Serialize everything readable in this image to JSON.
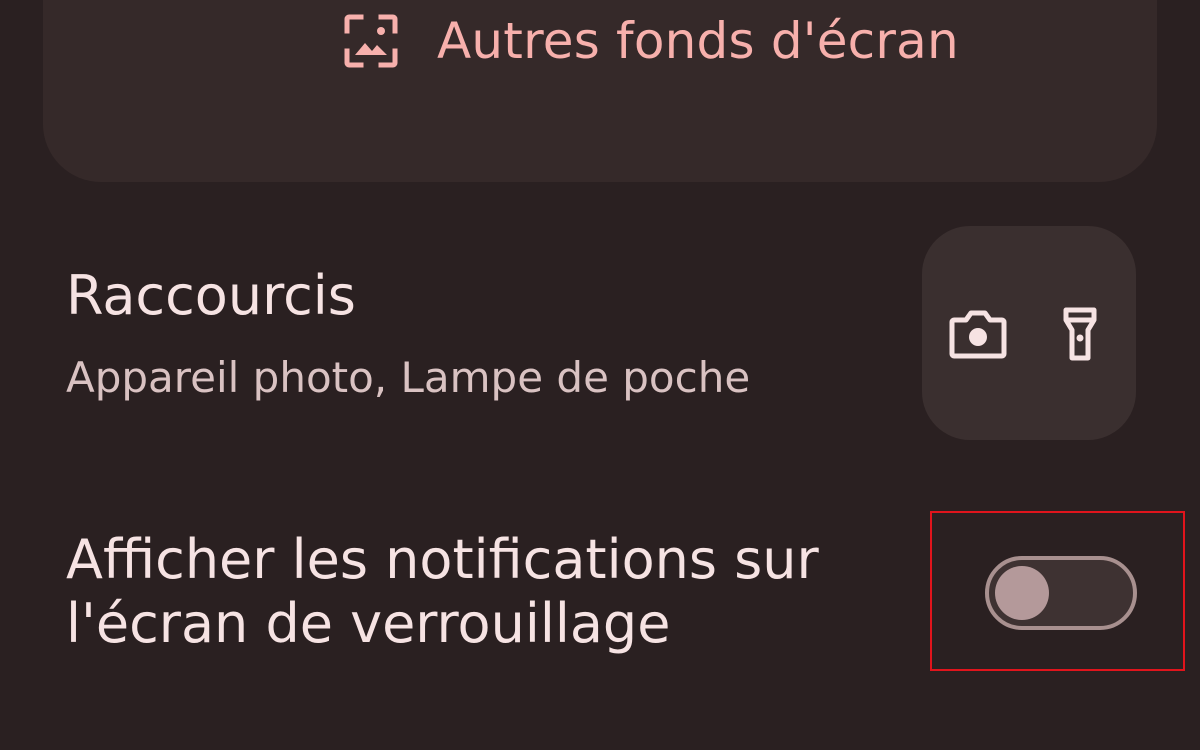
{
  "wallpaper": {
    "more_wallpapers_label": "Autres fonds d'écran",
    "more_wallpapers_icon": "image-icon"
  },
  "shortcuts": {
    "title": "Raccourcis",
    "subtitle": "Appareil photo, Lampe de poche",
    "icons": [
      "camera-icon",
      "flashlight-icon"
    ]
  },
  "notifications": {
    "title": "Afficher les notifications sur l'écran de verrouillage",
    "toggle_state": "off"
  },
  "colors": {
    "background": "#2a2021",
    "card": "#352929",
    "accent": "#f7b0ac",
    "highlight": "#e0141c"
  }
}
